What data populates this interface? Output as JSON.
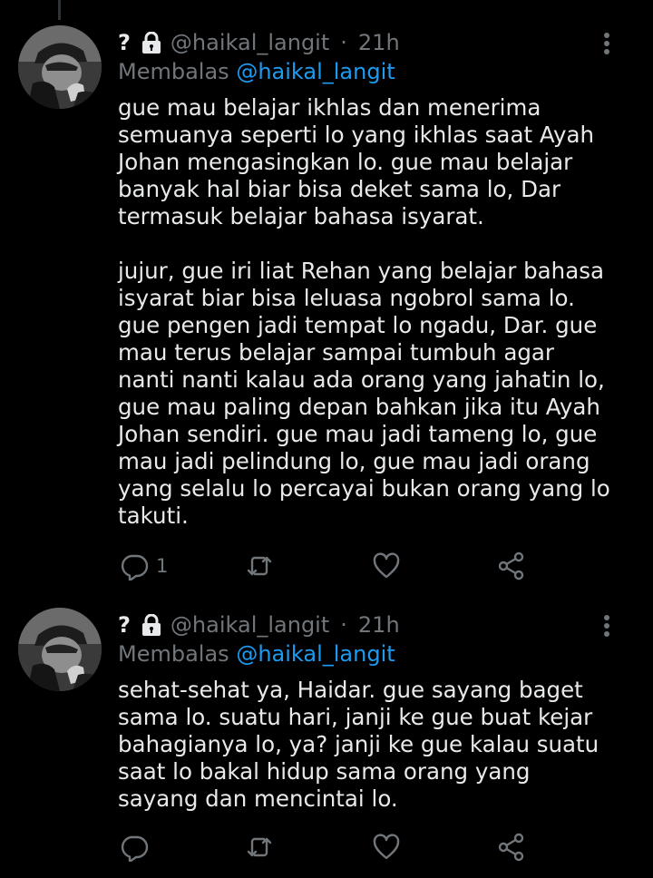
{
  "tweets": [
    {
      "name": "?",
      "handle": "@haikal_langit",
      "separator": "·",
      "time": "21h",
      "reply_prefix": "Membalas",
      "reply_mention": "@haikal_langit",
      "body_lines": [
        "gue mau belajar ikhlas dan menerima",
        "semuanya seperti lo yang ikhlas saat Ayah",
        "Johan mengasingkan lo. gue mau belajar",
        "banyak hal biar bisa deket sama lo, Dar",
        "termasuk belajar bahasa isyarat.",
        "",
        "jujur, gue iri liat Rehan yang belajar bahasa",
        "isyarat biar bisa leluasa ngobrol sama lo.",
        "gue pengen jadi tempat lo ngadu, Dar. gue",
        "mau terus belajar sampai tumbuh agar",
        "nanti nanti kalau ada orang yang jahatin lo,",
        "gue mau paling depan bahkan jika itu Ayah",
        "Johan sendiri. gue mau jadi tameng lo, gue",
        "mau jadi pelindung lo, gue mau jadi orang",
        "yang selalu lo percayai bukan orang yang lo",
        "takuti."
      ],
      "reply_count": "1"
    },
    {
      "name": "?",
      "handle": "@haikal_langit",
      "separator": "·",
      "time": "21h",
      "reply_prefix": "Membalas",
      "reply_mention": "@haikal_langit",
      "body_lines": [
        "sehat-sehat ya, Haidar. gue sayang baget",
        "sama lo. suatu hari, janji ke gue buat kejar",
        "bahagianya lo, ya? janji ke gue kalau suatu",
        "saat lo bakal hidup sama orang yang",
        "sayang dan mencintai lo."
      ],
      "reply_count": ""
    }
  ],
  "icons": {
    "lock": "lock-icon",
    "more": "more-vertical-icon",
    "reply": "reply-icon",
    "retweet": "retweet-icon",
    "like": "heart-icon",
    "share": "share-icon"
  },
  "colors": {
    "background": "#000000",
    "text": "#e7e9ea",
    "muted": "#71767b",
    "mention": "#1d9bf0"
  }
}
